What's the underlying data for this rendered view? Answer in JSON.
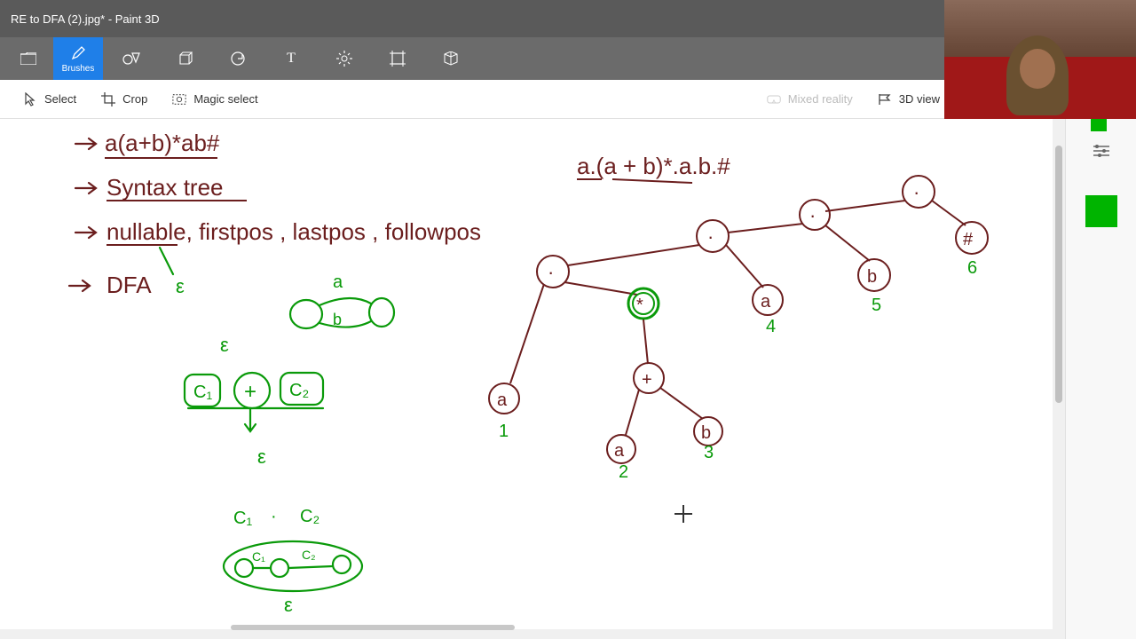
{
  "titlebar": {
    "title": "RE to DFA (2).jpg* - Paint 3D"
  },
  "mainbar": {
    "menu_label": "",
    "brushes_label": "Brushes",
    "shapes2d_label": "",
    "shapes3d_label": "",
    "stickers_label": "",
    "text_label": "",
    "effects_label": "",
    "canvas_label": "",
    "library_label": "",
    "paste_label": ""
  },
  "subbar": {
    "select_label": "Select",
    "crop_label": "Crop",
    "magic_label": "Magic select",
    "mixed_label": "Mixed reality",
    "view3d_label": "3D view"
  },
  "colors": {
    "current": "#00b400"
  },
  "canvas_notes": {
    "line1": "→ a(a+b)*ab#",
    "line2": "→ Syntax tree",
    "line3": "→ nullable, firstpos , lastpos , followpos",
    "line4": "→ DFA  ε",
    "expr": "a.(a + b)*.a.b.#",
    "leaf_labels": [
      "1",
      "2",
      "3",
      "4",
      "5",
      "6"
    ],
    "node_symbols": [
      "a",
      "a",
      "b",
      "+",
      "*",
      ".",
      "a",
      "b",
      "#",
      "."
    ],
    "green_c": [
      "C₁",
      "+",
      "C₂",
      "ε",
      "ε"
    ],
    "green_c2": [
      "C₁",
      "·",
      "C₂",
      "ε"
    ]
  }
}
